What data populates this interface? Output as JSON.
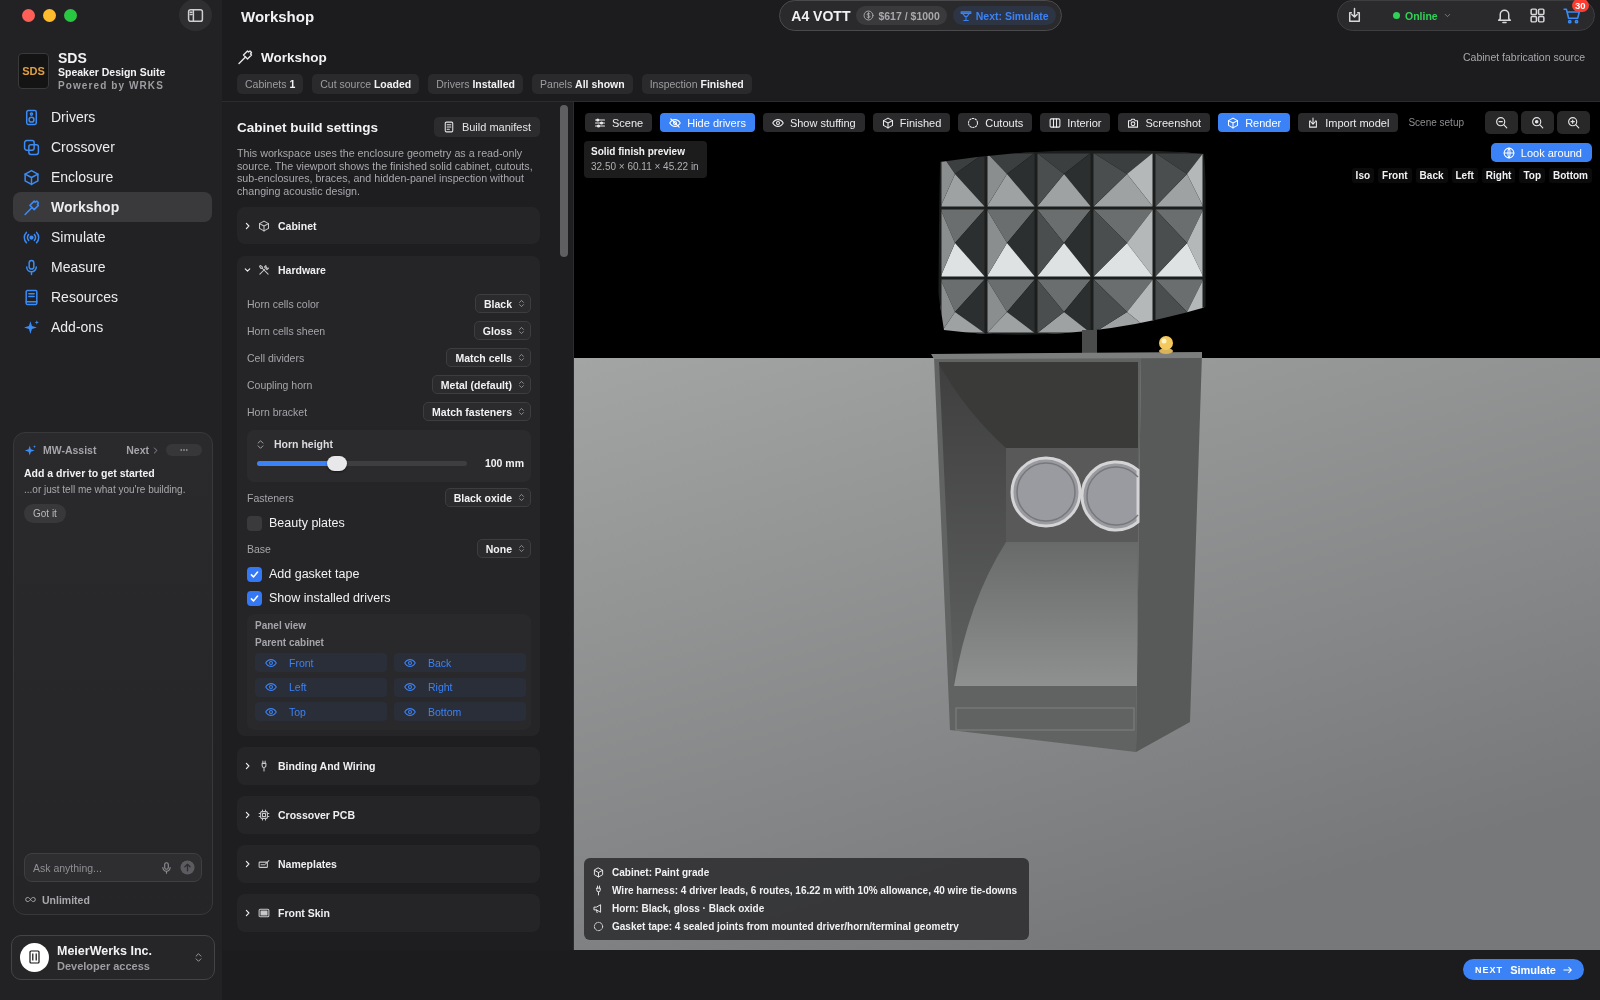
{
  "window": {
    "title": "Workshop"
  },
  "top_bar": {
    "project": "A4 VOTT",
    "budget": "$617 / $1000",
    "next_step": "Next: Simulate",
    "status": {
      "label": "Online",
      "online": true
    },
    "cart_count": "30"
  },
  "sidebar": {
    "logo_text": "SDS",
    "app_name": "SDS",
    "subtitle": "Speaker Design Suite",
    "powered_by": "Powered by WRKS",
    "items": [
      {
        "label": "Drivers",
        "selected": false
      },
      {
        "label": "Crossover",
        "selected": false
      },
      {
        "label": "Enclosure",
        "selected": false
      },
      {
        "label": "Workshop",
        "selected": true
      },
      {
        "label": "Simulate",
        "selected": false
      },
      {
        "label": "Measure",
        "selected": false
      },
      {
        "label": "Resources",
        "selected": false
      },
      {
        "label": "Add-ons",
        "selected": false
      }
    ],
    "assistant": {
      "name": "MW-Assist",
      "next": "Next",
      "title": "Add a driver to get started",
      "message": "...or just tell me what you're building.",
      "dismiss": "Got it",
      "input": {
        "placeholder": "Ask anything..."
      },
      "plan": "Unlimited"
    },
    "account": {
      "name": "MeierWerks Inc.",
      "role": "Developer access"
    }
  },
  "header": {
    "title": "Workshop",
    "chips": [
      {
        "label": "Cabinets",
        "value": "1"
      },
      {
        "label": "Cut source",
        "value": "Loaded"
      },
      {
        "label": "Drivers",
        "value": "Installed"
      },
      {
        "label": "Panels",
        "value": "All shown"
      },
      {
        "label": "Inspection",
        "value": "Finished"
      }
    ],
    "source_note": "Cabinet fabrication source"
  },
  "build_settings": {
    "title": "Cabinet build settings",
    "manifest_button": "Build manifest",
    "description": "This workspace uses the enclosure geometry as a read-only source. The viewport shows the finished solid cabinet, cutouts, sub-enclosures, braces, and hidden-panel inspection without changing acoustic design.",
    "sections": [
      {
        "title": "Cabinet",
        "expanded": false
      },
      {
        "title": "Hardware",
        "expanded": true,
        "fields": [
          {
            "kind": "select",
            "label": "Horn cells color",
            "value": "Black"
          },
          {
            "kind": "select",
            "label": "Horn cells sheen",
            "value": "Gloss"
          },
          {
            "kind": "select",
            "label": "Cell dividers",
            "value": "Match cells"
          },
          {
            "kind": "select",
            "label": "Coupling horn",
            "value": "Metal (default)"
          },
          {
            "kind": "select",
            "label": "Horn bracket",
            "value": "Match fasteners"
          },
          {
            "kind": "slider",
            "label": "Horn height",
            "level": 0.38,
            "reading": "100 mm"
          },
          {
            "kind": "select",
            "label": "Fasteners",
            "value": "Black oxide"
          },
          {
            "kind": "checkbox",
            "label": "Beauty plates",
            "checked": false
          },
          {
            "kind": "select",
            "label": "Base",
            "value": "None"
          },
          {
            "kind": "checkbox",
            "label": "Add gasket tape",
            "checked": true
          },
          {
            "kind": "checkbox",
            "label": "Show installed drivers",
            "checked": true
          },
          {
            "kind": "panel_view",
            "title": "Panel view",
            "subtitle": "Parent cabinet",
            "panels": [
              {
                "label": "Front",
                "visible": true
              },
              {
                "label": "Back",
                "visible": true
              },
              {
                "label": "Left",
                "visible": true
              },
              {
                "label": "Right",
                "visible": true
              },
              {
                "label": "Top",
                "visible": true
              },
              {
                "label": "Bottom",
                "visible": true
              }
            ]
          }
        ]
      },
      {
        "title": "Binding And Wiring",
        "expanded": false
      },
      {
        "title": "Crossover PCB",
        "expanded": false
      },
      {
        "title": "Nameplates",
        "expanded": false
      },
      {
        "title": "Front Skin",
        "expanded": false
      }
    ]
  },
  "viewport": {
    "tools": [
      {
        "label": "Scene",
        "selected": false
      },
      {
        "label": "Hide drivers",
        "selected": true
      },
      {
        "label": "Show stuffing",
        "selected": false
      },
      {
        "label": "Finished",
        "selected": false
      },
      {
        "label": "Cutouts",
        "selected": false
      },
      {
        "label": "Interior",
        "selected": false
      },
      {
        "label": "Screenshot",
        "selected": false
      },
      {
        "label": "Render",
        "selected": true
      },
      {
        "label": "Import model",
        "selected": false
      }
    ],
    "scene_setup": "Scene setup",
    "preview": {
      "title": "Solid finish preview",
      "dimensions": "32.50 × 60.11 × 45.22 in"
    },
    "look_around": "Look around",
    "views": [
      "Iso",
      "Front",
      "Back",
      "Left",
      "Right",
      "Top",
      "Bottom"
    ],
    "summary": [
      "Cabinet: Paint grade",
      "Wire harness: 4 driver leads, 6 routes, 16.22 m with 10% allowance, 40 wire tie-downs",
      "Horn: Black, gloss · Black oxide",
      "Gasket tape: 4 sealed joints from mounted driver/horn/terminal geometry"
    ]
  },
  "next_button": {
    "prefix": "NEXT",
    "label": "Simulate"
  }
}
